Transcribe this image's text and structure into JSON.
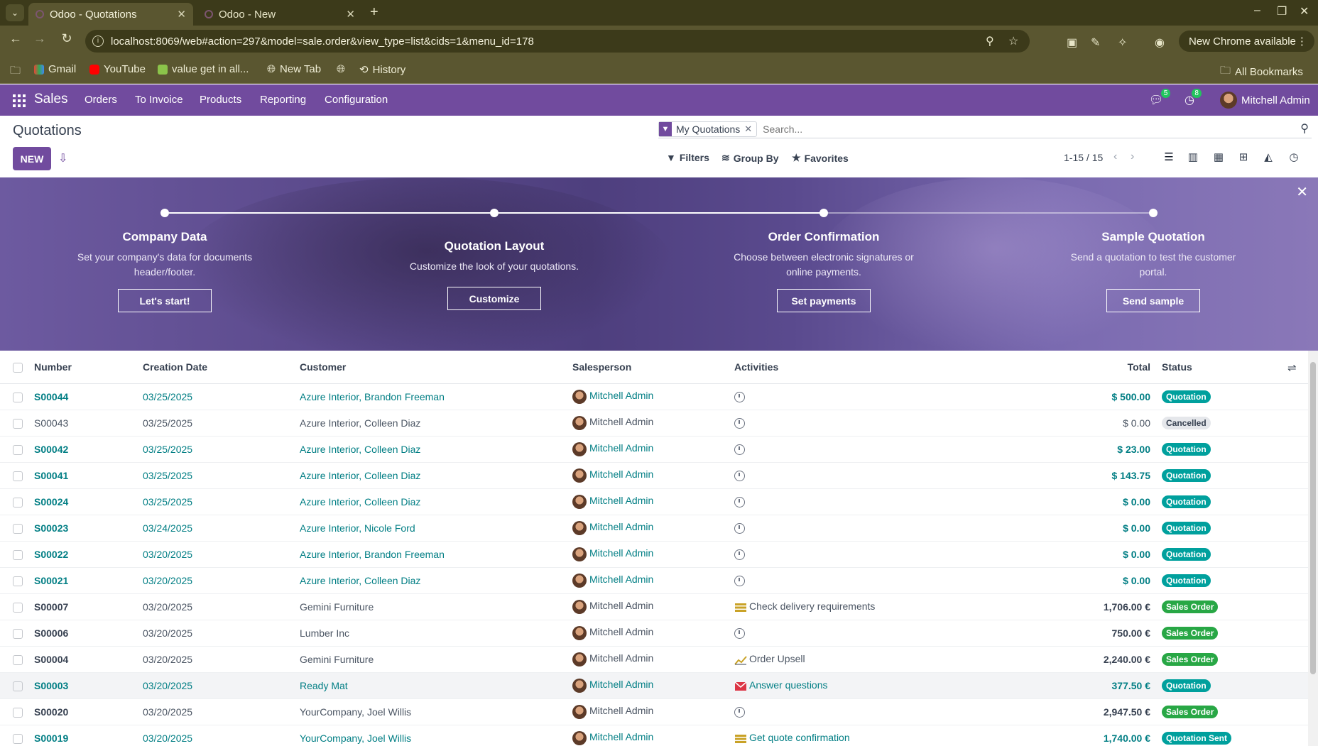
{
  "browser": {
    "tabs": [
      {
        "title": "Odoo - Quotations",
        "active": true
      },
      {
        "title": "Odoo - New",
        "active": false
      }
    ],
    "url": "localhost:8069/web#action=297&model=sale.order&view_type=list&cids=1&menu_id=178",
    "new_chrome_label": "New Chrome available",
    "bookmarks": [
      "Gmail",
      "YouTube",
      "value get in all...",
      "New Tab",
      "History"
    ],
    "all_bookmarks_label": "All Bookmarks"
  },
  "odoo_nav": {
    "app": "Sales",
    "menu": [
      "Orders",
      "To Invoice",
      "Products",
      "Reporting",
      "Configuration"
    ],
    "messages_count": "5",
    "activities_count": "8",
    "user": "Mitchell Admin",
    "accent": "#714b9e"
  },
  "control_panel": {
    "title": "Quotations",
    "new_label": "NEW",
    "facet_label": "My Quotations",
    "search_placeholder": "Search...",
    "filters_label": "Filters",
    "groupby_label": "Group By",
    "favorites_label": "Favorites",
    "pager": "1-15 / 15"
  },
  "banner": {
    "steps": [
      {
        "title": "Company Data",
        "desc": "Set your company's data for documents header/footer.",
        "button": "Let's start!"
      },
      {
        "title": "Quotation Layout",
        "desc": "Customize the look of your quotations.",
        "button": "Customize"
      },
      {
        "title": "Order Confirmation",
        "desc": "Choose between electronic signatures or online payments.",
        "button": "Set payments"
      },
      {
        "title": "Sample Quotation",
        "desc": "Send a quotation to test the customer portal.",
        "button": "Send sample"
      }
    ]
  },
  "table": {
    "columns": [
      "Number",
      "Creation Date",
      "Customer",
      "Salesperson",
      "Activities",
      "Total",
      "Status"
    ],
    "rows": [
      {
        "number": "S00044",
        "date": "03/25/2025",
        "customer": "Azure Interior, Brandon Freeman",
        "salesperson": "Mitchell Admin",
        "activity": "",
        "total": "$ 500.00",
        "status": "Quotation"
      },
      {
        "number": "S00043",
        "date": "03/25/2025",
        "customer": "Azure Interior, Colleen Diaz",
        "salesperson": "Mitchell Admin",
        "activity": "",
        "total": "$ 0.00",
        "status": "Cancelled"
      },
      {
        "number": "S00042",
        "date": "03/25/2025",
        "customer": "Azure Interior, Colleen Diaz",
        "salesperson": "Mitchell Admin",
        "activity": "",
        "total": "$ 23.00",
        "status": "Quotation"
      },
      {
        "number": "S00041",
        "date": "03/25/2025",
        "customer": "Azure Interior, Colleen Diaz",
        "salesperson": "Mitchell Admin",
        "activity": "",
        "total": "$ 143.75",
        "status": "Quotation"
      },
      {
        "number": "S00024",
        "date": "03/25/2025",
        "customer": "Azure Interior, Colleen Diaz",
        "salesperson": "Mitchell Admin",
        "activity": "",
        "total": "$ 0.00",
        "status": "Quotation"
      },
      {
        "number": "S00023",
        "date": "03/24/2025",
        "customer": "Azure Interior, Nicole Ford",
        "salesperson": "Mitchell Admin",
        "activity": "",
        "total": "$ 0.00",
        "status": "Quotation"
      },
      {
        "number": "S00022",
        "date": "03/20/2025",
        "customer": "Azure Interior, Brandon Freeman",
        "salesperson": "Mitchell Admin",
        "activity": "",
        "total": "$ 0.00",
        "status": "Quotation"
      },
      {
        "number": "S00021",
        "date": "03/20/2025",
        "customer": "Azure Interior, Colleen Diaz",
        "salesperson": "Mitchell Admin",
        "activity": "",
        "total": "$ 0.00",
        "status": "Quotation"
      },
      {
        "number": "S00007",
        "date": "03/20/2025",
        "customer": "Gemini Furniture",
        "salesperson": "Mitchell Admin",
        "activity": "Check delivery requirements",
        "total": "1,706.00 €",
        "status": "Sales Order"
      },
      {
        "number": "S00006",
        "date": "03/20/2025",
        "customer": "Lumber Inc",
        "salesperson": "Mitchell Admin",
        "activity": "",
        "total": "750.00 €",
        "status": "Sales Order"
      },
      {
        "number": "S00004",
        "date": "03/20/2025",
        "customer": "Gemini Furniture",
        "salesperson": "Mitchell Admin",
        "activity": "Order Upsell",
        "total": "2,240.00 €",
        "status": "Sales Order"
      },
      {
        "number": "S00003",
        "date": "03/20/2025",
        "customer": "Ready Mat",
        "salesperson": "Mitchell Admin",
        "activity": "Answer questions",
        "total": "377.50 €",
        "status": "Quotation"
      },
      {
        "number": "S00020",
        "date": "03/20/2025",
        "customer": "YourCompany, Joel Willis",
        "salesperson": "Mitchell Admin",
        "activity": "",
        "total": "2,947.50 €",
        "status": "Sales Order"
      },
      {
        "number": "S00019",
        "date": "03/20/2025",
        "customer": "YourCompany, Joel Willis",
        "salesperson": "Mitchell Admin",
        "activity": "Get quote confirmation",
        "total": "1,740.00 €",
        "status": "Quotation Sent"
      }
    ]
  }
}
